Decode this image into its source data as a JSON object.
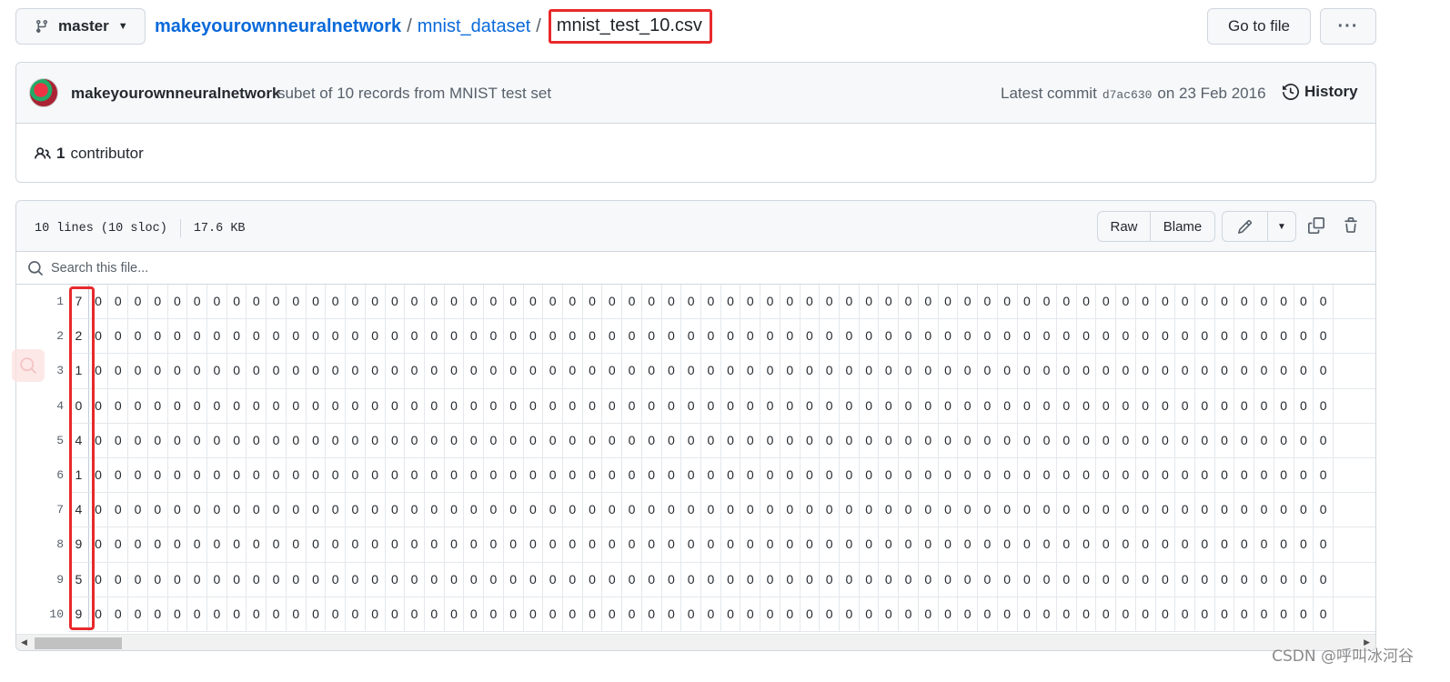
{
  "branch": {
    "label": "master"
  },
  "breadcrumb": {
    "repo": "makeyourownneuralnetwork",
    "sep": "/",
    "dir": "mnist_dataset",
    "file": "mnist_test_10.csv"
  },
  "actions": {
    "go_to_file": "Go to file",
    "more": "···"
  },
  "commit": {
    "author": "makeyourownneuralnetwork",
    "message": "subet of 10 records from MNIST test set",
    "latest_prefix": "Latest commit",
    "sha": "d7ac630",
    "date": "on 23 Feb 2016",
    "history": "History"
  },
  "contributors": {
    "count": "1",
    "label": "contributor"
  },
  "file": {
    "lines": "10 lines (10 sloc)",
    "size": "17.6 KB",
    "raw": "Raw",
    "blame": "Blame",
    "search_placeholder": "Search this file..."
  },
  "table": {
    "line_numbers": [
      "1",
      "2",
      "3",
      "4",
      "5",
      "6",
      "7",
      "8",
      "9",
      "10"
    ],
    "labels": [
      "7",
      "2",
      "1",
      "0",
      "4",
      "1",
      "4",
      "9",
      "5",
      "9"
    ],
    "pixel_value": "0",
    "visible_columns": 64
  },
  "icons": [
    "branch-icon",
    "chevron-down-icon",
    "kebab-icon",
    "history-icon",
    "people-icon",
    "pencil-icon",
    "copy-icon",
    "trash-icon",
    "search-icon"
  ],
  "colors": {
    "link": "#0969da",
    "highlight": "#e8292b",
    "border": "#d0d7de",
    "header_bg": "#f6f8fa"
  },
  "watermark": "CSDN @呼叫冰河谷"
}
